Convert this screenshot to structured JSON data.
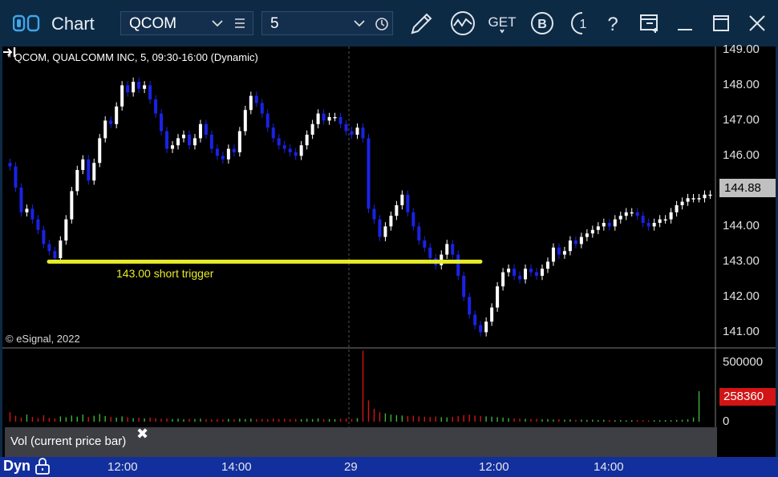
{
  "window": {
    "title": "Chart"
  },
  "toolbar": {
    "symbol": "QCOM",
    "interval": "5",
    "get_label": "GET",
    "b_label": "B",
    "one_label": "1",
    "help_label": "?"
  },
  "chart": {
    "title": "* QCOM, QUALCOMM INC, 5, 09:30-16:00 (Dynamic)",
    "copyright": "© eSignal, 2022",
    "trigger_label": "143.00 short trigger",
    "last_price": "144.88",
    "last_volume": "258360",
    "study_label": "Vol (current price bar)",
    "study_close": "✖",
    "dyn_label": "Dyn"
  },
  "colors": {
    "background": "#000000",
    "frame": "#0d2a45",
    "up_bar": "#ffffff",
    "down_bar": "#1a22e6",
    "trigger_line": "#e6ec2a",
    "vol_up": "#3cb43c",
    "vol_down": "#d21414",
    "time_axis": "#122f9e"
  },
  "chart_data": {
    "type": "candlestick",
    "price_axis": {
      "min": 140.6,
      "max": 149.1,
      "ticks": [
        "149.00",
        "148.00",
        "147.00",
        "146.00",
        "145.00",
        "144.00",
        "143.00",
        "142.00",
        "141.00"
      ]
    },
    "volume_axis": {
      "min": 0,
      "max": 610000,
      "ticks": [
        "500000",
        "0"
      ]
    },
    "time_labels": [
      "12:00",
      "14:00",
      "29",
      "12:00",
      "14:00"
    ],
    "horizontal_line": {
      "price": 143.0
    },
    "last_price": 144.88,
    "last_volume": 258360,
    "closes": [
      145.7,
      145.1,
      144.4,
      144.5,
      144.2,
      143.9,
      143.5,
      143.3,
      143.1,
      143.6,
      144.2,
      145.0,
      145.6,
      145.9,
      145.3,
      145.8,
      146.5,
      147.0,
      146.9,
      147.4,
      148.0,
      147.8,
      148.1,
      147.9,
      148.0,
      147.6,
      147.2,
      146.7,
      146.2,
      146.3,
      146.5,
      146.6,
      146.3,
      146.5,
      146.9,
      146.6,
      146.2,
      146.0,
      145.9,
      146.2,
      146.1,
      146.7,
      147.3,
      147.7,
      147.5,
      147.2,
      146.8,
      146.5,
      146.3,
      146.2,
      146.1,
      146.0,
      146.3,
      146.6,
      146.9,
      147.2,
      147.0,
      147.1,
      147.1,
      146.9,
      146.7,
      146.6,
      146.8,
      146.5,
      144.5,
      144.2,
      143.7,
      144.0,
      144.3,
      144.6,
      144.9,
      144.4,
      144.0,
      143.6,
      143.4,
      143.1,
      142.9,
      143.2,
      143.5,
      143.2,
      142.6,
      142.0,
      141.5,
      141.2,
      141.0,
      141.3,
      141.7,
      142.3,
      142.7,
      142.8,
      142.6,
      142.5,
      142.8,
      142.7,
      142.6,
      142.8,
      143.0,
      143.4,
      143.2,
      143.3,
      143.6,
      143.5,
      143.7,
      143.8,
      143.9,
      144.0,
      144.1,
      144.0,
      144.2,
      144.3,
      144.4,
      144.4,
      144.3,
      144.1,
      144.0,
      144.1,
      144.2,
      144.2,
      144.4,
      144.6,
      144.7,
      144.8,
      144.8,
      144.8,
      144.9,
      144.9
    ],
    "volumes": [
      80000,
      50000,
      35000,
      60000,
      40000,
      30000,
      55000,
      32000,
      28000,
      45000,
      38000,
      52000,
      42000,
      60000,
      38000,
      50000,
      65000,
      48000,
      40000,
      35000,
      45000,
      38000,
      30000,
      34000,
      28000,
      36000,
      30000,
      24000,
      28000,
      22000,
      26000,
      20000,
      24000,
      22000,
      26000,
      20000,
      18000,
      22000,
      19000,
      24000,
      20000,
      26000,
      22000,
      25000,
      21000,
      23000,
      20000,
      26000,
      22000,
      24000,
      20000,
      23000,
      21000,
      25000,
      22000,
      28000,
      20000,
      23000,
      21000,
      24000,
      28000,
      22000,
      30000,
      600000,
      180000,
      110000,
      80000,
      70000,
      60000,
      55000,
      52000,
      48000,
      50000,
      45000,
      42000,
      40000,
      44000,
      38000,
      36000,
      40000,
      48000,
      55000,
      60000,
      52000,
      48000,
      45000,
      42000,
      38000,
      35000,
      30000,
      28000,
      26000,
      24000,
      22000,
      24000,
      20000,
      22000,
      18000,
      20000,
      17000,
      19000,
      16000,
      18000,
      15000,
      17000,
      14000,
      16000,
      15000,
      13000,
      14000,
      12000,
      13000,
      14000,
      12000,
      11000,
      13000,
      12000,
      14000,
      13000,
      15000,
      16000,
      20000,
      35000,
      258360
    ]
  }
}
